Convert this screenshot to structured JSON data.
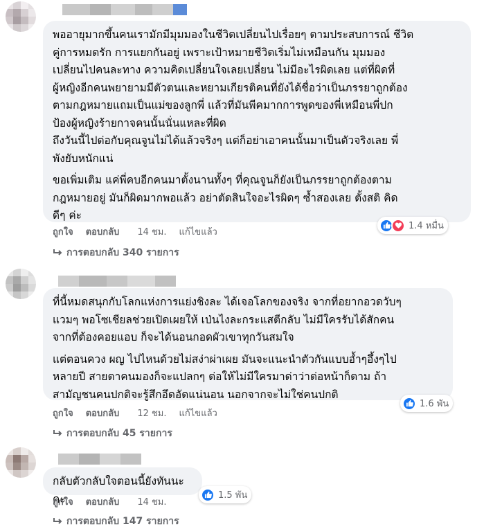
{
  "comments": [
    {
      "paragraph1": "พออายุมากขึ้นคนเรามักมีมุมมองในชีวิตเปลี่ยนไปเรื่อยๆ ตามประสบการณ์ ชีวิต\nคู่การหมดรัก การแยกกันอยู่ เพราะเป้าหมายชีวิตเริ่มไม่เหมือนกัน มุมมอง\nเปลี่ยนไปคนละทาง ความคิดเปลี่ยนใจเลยเปลี่ยน ไม่มีอะไรผิดเลย แต่ที่ผิดที่\nผู้หญิงอีกคนพยายามมีตัวตนและหยามเกียรติคนที่ยังได้ชื่อว่าเป็นภรรยาถูกต้อง\nตามกฎหมายแถมเป็นแม่ของลูกพี่ แล้วที่มันพีคมากการพูดของพี่เหมือนพี่ปก\nป้องผู้หญิงร้ายกาจคนนั้นนั่นแหละที่ผิด\nถึงวันนี้ไปต่อกับคุณจูนไม่ได้แล้วจริงๆ แต่ก็อย่าเอาคนนั้นมาเป็นตัวจริงเลย พี่\nพังยับหนักแน่",
      "paragraph2": "ขอเพิ่มเติม แค่พี่คบอีกคนมาตั้งนานทั้งๆ ที่คุณจูนก็ยังเป็นภรรยาถูกต้องตาม\nกฎหมายอยู่ มันก็ผิดมากพอแล้ว อย่าตัดสินใจอะไรผิดๆ ซ้ำสองเลย ตั้งสติ คิด\nดีๆ ค่ะ",
      "like": "ถูกใจ",
      "reply": "ตอบกลับ",
      "time": "14 ชม.",
      "edited": "แก้ไขแล้ว",
      "reaction_count": "1.4 หมื่น",
      "replies_label": "การตอบกลับ 340 รายการ"
    },
    {
      "paragraph1": "ที่นี้หมดสนุกกับโลกแห่งการแย่งชิงละ ได้เจอโลกของจริง จากที่อยากอวดวับๆ\nแวมๆ พอโซเชียลช่วยเปิดเผยให้ เป่นไงละกระแสตีกลับ ไม่มีใครรับได้สักคน\nจากที่ต้องคอยแอบ ก็จะได้นอนกอดผัวเขาทุกวันสมใจ",
      "paragraph2": "แต่ตอนควง ผญ ไปไหนด้วยไม่สง่าผ่าเผย มันจะแนะนำตัวกันแบบอ้ำๆอึ้งๆไป\nหลายปี สายตาคนมองก็จะแปลกๆ ต่อให้ไม่มีใครมาด่าว่าต่อหน้าก็ตาม ถ้า\nสามัญชนคนปกติจะรู้สึกอึดอัดแน่นอน นอกจากจะไม่ใช่คนปกติ",
      "like": "ถูกใจ",
      "reply": "ตอบกลับ",
      "time": "12 ชม.",
      "edited": "แก้ไขแล้ว",
      "reaction_count": "1.6 พัน",
      "replies_label": "การตอบกลับ 45 รายการ"
    },
    {
      "paragraph1": "กลับตัวกลับใจตอนนี้ยังทันนะคะ",
      "like": "ถูกใจ",
      "reply": "ตอบกลับ",
      "time": "14 ชม.",
      "reaction_count": "1.5 พัน",
      "replies_label": "การตอบกลับ 147 รายการ"
    }
  ],
  "colors": {
    "bubble": "#f0f2f5",
    "secondary_text": "#65676b",
    "like_blue": "#1877f2",
    "love_red": "#f33e58"
  },
  "icons": {
    "like": "thumbs-up-icon",
    "love": "heart-icon",
    "replies": "reply-arrow-icon"
  }
}
